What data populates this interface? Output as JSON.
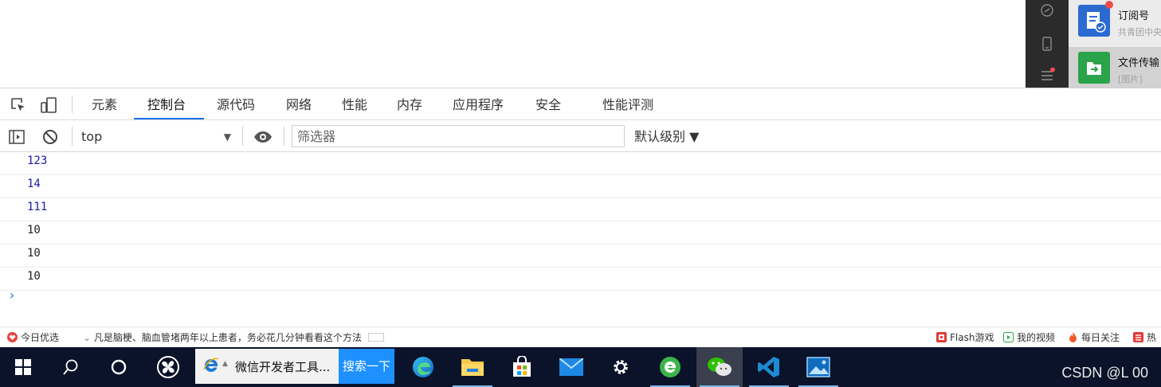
{
  "devtools": {
    "tabs": [
      {
        "label": "元素"
      },
      {
        "label": "控制台"
      },
      {
        "label": "源代码"
      },
      {
        "label": "网络"
      },
      {
        "label": "性能"
      },
      {
        "label": "内存"
      },
      {
        "label": "应用程序"
      },
      {
        "label": "安全"
      },
      {
        "label": "性能评测"
      }
    ],
    "active_tab": "控制台",
    "toolbar": {
      "context": "top",
      "filter_placeholder": "筛选器",
      "level": "默认级别 ▼"
    },
    "console_lines": [
      "123",
      "14",
      "111",
      "10",
      "10",
      "10"
    ],
    "prompt": "›"
  },
  "statusbar": {
    "left": {
      "today": "今日优选",
      "news": "凡是脑梗、脑血管堵两年以上患者，务必花几分钟看看这个方法"
    },
    "right": {
      "flash": "Flash游戏",
      "videos": "我的视频",
      "daily": "每日关注",
      "hot": "热"
    }
  },
  "taskbar": {
    "window_title": "微信开发者工具...",
    "search_button": "搜索一下",
    "watermark": "CSDN @L 00"
  },
  "notifications": {
    "items": [
      {
        "title": "订阅号",
        "subtitle": "共青团中央"
      },
      {
        "title": "文件传输",
        "subtitle": "[图片]"
      }
    ]
  },
  "colors": {
    "accent": "#1a73e8",
    "console_number": "#1a1aa6",
    "taskbar": "#0a1329"
  }
}
